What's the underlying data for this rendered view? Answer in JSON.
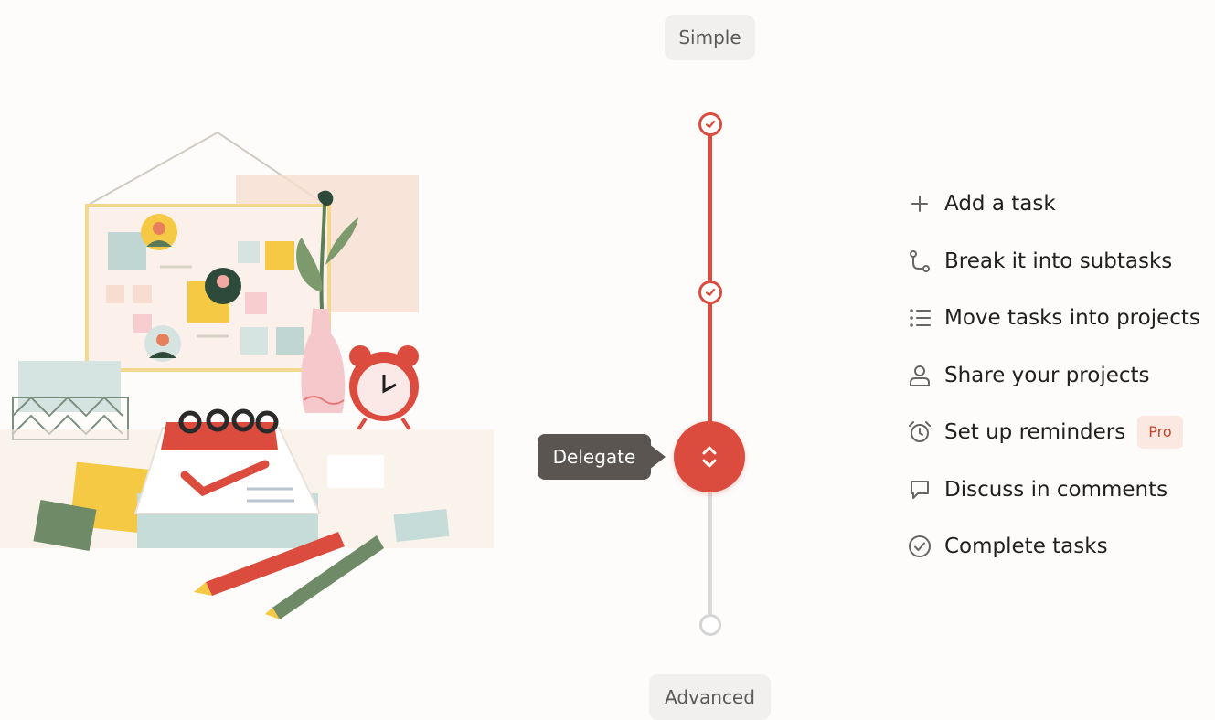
{
  "slider": {
    "top_label": "Simple",
    "bottom_label": "Advanced",
    "tooltip": "Delegate",
    "accent_color": "#dc4c3e",
    "inactive_color": "#dadada",
    "completed_steps": 2,
    "handle_icon": "chevron-up-down-icon"
  },
  "features": [
    {
      "label": "Add a task",
      "icon": "plus-icon"
    },
    {
      "label": "Break it into subtasks",
      "icon": "subtask-icon"
    },
    {
      "label": "Move tasks into projects",
      "icon": "list-icon"
    },
    {
      "label": "Share your projects",
      "icon": "person-icon"
    },
    {
      "label": "Set up reminders",
      "icon": "alarm-icon",
      "badge": "Pro"
    },
    {
      "label": "Discuss in comments",
      "icon": "comment-icon"
    },
    {
      "label": "Complete tasks",
      "icon": "check-circle-icon"
    }
  ]
}
